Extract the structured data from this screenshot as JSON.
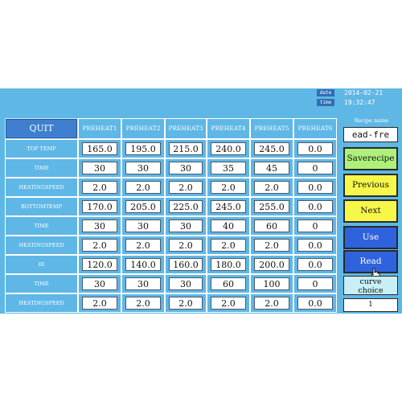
{
  "status": {
    "date_tag": "date",
    "date_value": "2014-02-21",
    "time_tag": "time",
    "time_value": "19:32:47"
  },
  "quit_label": "QUIT",
  "columns": [
    "PREHEAT1",
    "PREHEAT2",
    "PREHEAT3",
    "PREHEAT4",
    "PREHEAT5",
    "PREHEAT6"
  ],
  "rows": [
    {
      "label": "TOP TEMP",
      "values": [
        "165.0",
        "195.0",
        "215.0",
        "240.0",
        "245.0",
        "0.0"
      ]
    },
    {
      "label": "TIME",
      "values": [
        "30",
        "30",
        "30",
        "35",
        "45",
        "0"
      ]
    },
    {
      "label": "HEATINGSPEED",
      "values": [
        "2.0",
        "2.0",
        "2.0",
        "2.0",
        "2.0",
        "0.0"
      ]
    },
    {
      "label": "BOTTOMTEMP",
      "values": [
        "170.0",
        "205.0",
        "225.0",
        "245.0",
        "255.0",
        "0.0"
      ]
    },
    {
      "label": "TIME",
      "values": [
        "30",
        "30",
        "30",
        "40",
        "60",
        "0"
      ]
    },
    {
      "label": "HEATINGSPEED",
      "values": [
        "2.0",
        "2.0",
        "2.0",
        "2.0",
        "2.0",
        "0.0"
      ]
    },
    {
      "label": "IR",
      "values": [
        "120.0",
        "140.0",
        "160.0",
        "180.0",
        "200.0",
        "0.0"
      ]
    },
    {
      "label": "TIME",
      "values": [
        "30",
        "30",
        "30",
        "60",
        "100",
        "0"
      ]
    },
    {
      "label": "HEATINGSPEED",
      "values": [
        "2.0",
        "2.0",
        "2.0",
        "2.0",
        "2.0",
        "0.0"
      ]
    }
  ],
  "recipe": {
    "label": "Recipe name",
    "name": "ead-fre"
  },
  "buttons": [
    {
      "id": "saverecipe",
      "label": "Saverecipe",
      "bg": "#aef07a",
      "color": "#111111"
    },
    {
      "id": "previous",
      "label": "Previous",
      "bg": "#f7f74a",
      "color": "#111111"
    },
    {
      "id": "next",
      "label": "Next",
      "bg": "#f7f74a",
      "color": "#111111"
    },
    {
      "id": "use",
      "label": "Use",
      "bg": "#2f62dd",
      "color": "#ffffff"
    },
    {
      "id": "read",
      "label": "Read",
      "bg": "#2f62dd",
      "color": "#ffffff"
    }
  ],
  "curve": {
    "label_line1": "curve",
    "label_line2": "choice",
    "value": "1"
  },
  "colors": {
    "screen_bg": "#5fb7e6",
    "grid_line": "#ffffff",
    "quit_bg": "#3f7fd0"
  },
  "icons": {
    "pointer": "hand-pointer-icon"
  }
}
